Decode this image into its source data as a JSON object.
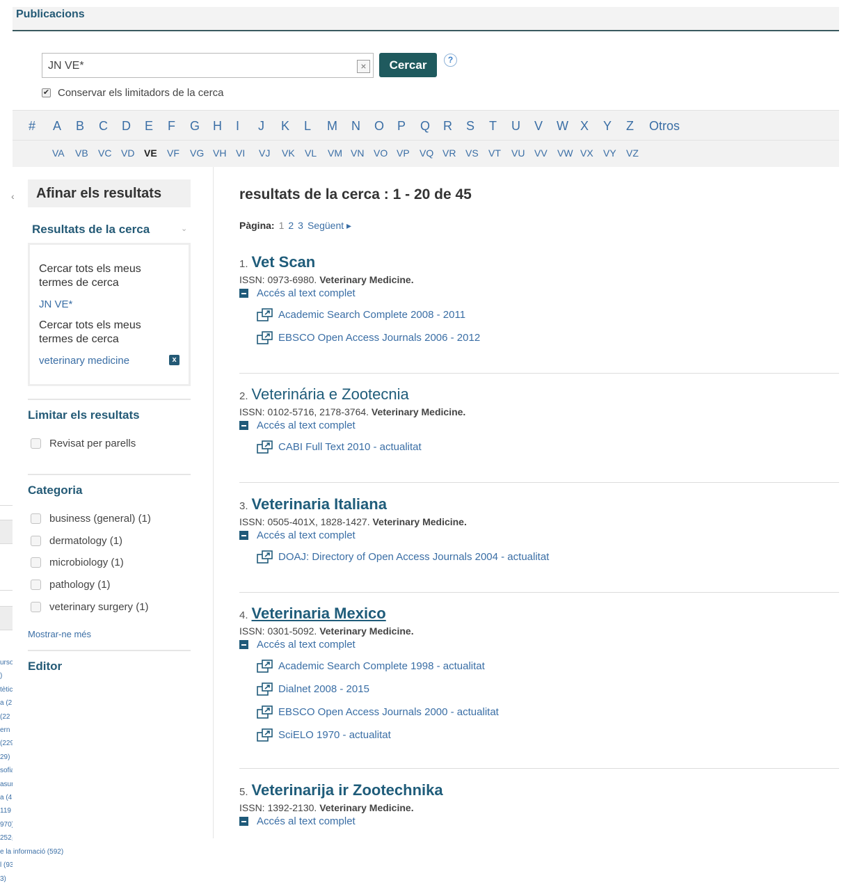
{
  "header": {
    "title": "Publicacions"
  },
  "search": {
    "value": "JN VE*",
    "button_label": "Cercar",
    "clear_glyph": "×",
    "help_glyph": "?",
    "keep_limiters_label": "Conservar els limitadors de la cerca",
    "keep_limiters_checked": true,
    "check_glyph": "✔"
  },
  "alphabet": [
    "#",
    "A",
    "B",
    "C",
    "D",
    "E",
    "F",
    "G",
    "H",
    "I",
    "J",
    "K",
    "L",
    "M",
    "N",
    "O",
    "P",
    "Q",
    "R",
    "S",
    "T",
    "U",
    "V",
    "W",
    "X",
    "Y",
    "Z",
    "Otros"
  ],
  "sub_alphabet": [
    "VA",
    "VB",
    "VC",
    "VD",
    "VE",
    "VF",
    "VG",
    "VH",
    "VI",
    "VJ",
    "VK",
    "VL",
    "VM",
    "VN",
    "VO",
    "VP",
    "VQ",
    "VR",
    "VS",
    "VT",
    "VU",
    "VV",
    "VW",
    "VX",
    "VY",
    "VZ"
  ],
  "sub_alphabet_active": "VE",
  "sidebar": {
    "collapse_glyph": "‹",
    "refine_title": "Afinar els resultats",
    "search_results_header": "Resultats de la cerca",
    "chevron_glyph": "⌄",
    "search_criteria": [
      {
        "label": "Cercar tots els meus termes de cerca",
        "term": "JN VE*"
      },
      {
        "label": "Cercar tots els meus termes de cerca",
        "term": "veterinary medicine"
      }
    ],
    "remove_glyph": "x",
    "limit_title": "Limitar els resultats",
    "limit_options": [
      "Revisat per parells"
    ],
    "category_title": "Categoria",
    "categories": [
      "business (general) (1)",
      "dermatology (1)",
      "microbiology (1)",
      "pathology (1)",
      "veterinary surgery (1)"
    ],
    "show_more": "Mostrar-ne més",
    "editor_title": "Editor"
  },
  "background_fragments": [
    "urso",
    ")",
    "tètic",
    "a (2",
    "(22",
    "ern",
    "(229",
    "29)",
    "sofia",
    "asur",
    "a (4:",
    "119",
    "970)",
    "252₃",
    "e la informació (592)",
    "l (93)",
    "3)"
  ],
  "results": {
    "heading": "resultats de la cerca : 1 - 20 de 45",
    "pagination": {
      "label": "Pàgina:",
      "pages": [
        "1",
        "2",
        "3"
      ],
      "current": "1",
      "next": "Següent ▸"
    },
    "full_text_label": "Accés al text complet",
    "items": [
      {
        "num": "1.",
        "title": "Vet Scan",
        "title_style": "bold",
        "issn_prefix": "ISSN: 0973-6980.",
        "subject": "Veterinary Medicine.",
        "databases": [
          "Academic Search Complete 2008 - 2011",
          "EBSCO Open Access Journals 2006 - 2012"
        ]
      },
      {
        "num": "2.",
        "title": "Veterinária e Zootecnia",
        "title_style": "normal",
        "issn_prefix": "ISSN: 0102-5716, 2178-3764.",
        "subject": "Veterinary Medicine.",
        "databases": [
          "CABI Full Text 2010 - actualitat"
        ]
      },
      {
        "num": "3.",
        "title": "Veterinaria Italiana",
        "title_style": "bold",
        "issn_prefix": "ISSN: 0505-401X, 1828-1427.",
        "subject": "Veterinary Medicine.",
        "databases": [
          "DOAJ: Directory of Open Access Journals 2004 - actualitat"
        ]
      },
      {
        "num": "4.",
        "title": "Veterinaria Mexico",
        "title_style": "bold-underline",
        "issn_prefix": "ISSN: 0301-5092.",
        "subject": "Veterinary Medicine.",
        "databases": [
          "Academic Search Complete 1998 - actualitat",
          "Dialnet 2008 - 2015",
          "EBSCO Open Access Journals 2000 - actualitat",
          "SciELO 1970 - actualitat"
        ]
      },
      {
        "num": "5.",
        "title": "Veterinarija ir Zootechnika",
        "title_style": "bold",
        "issn_prefix": "ISSN: 1392-2130.",
        "subject": "Veterinary Medicine.",
        "databases": []
      }
    ]
  }
}
